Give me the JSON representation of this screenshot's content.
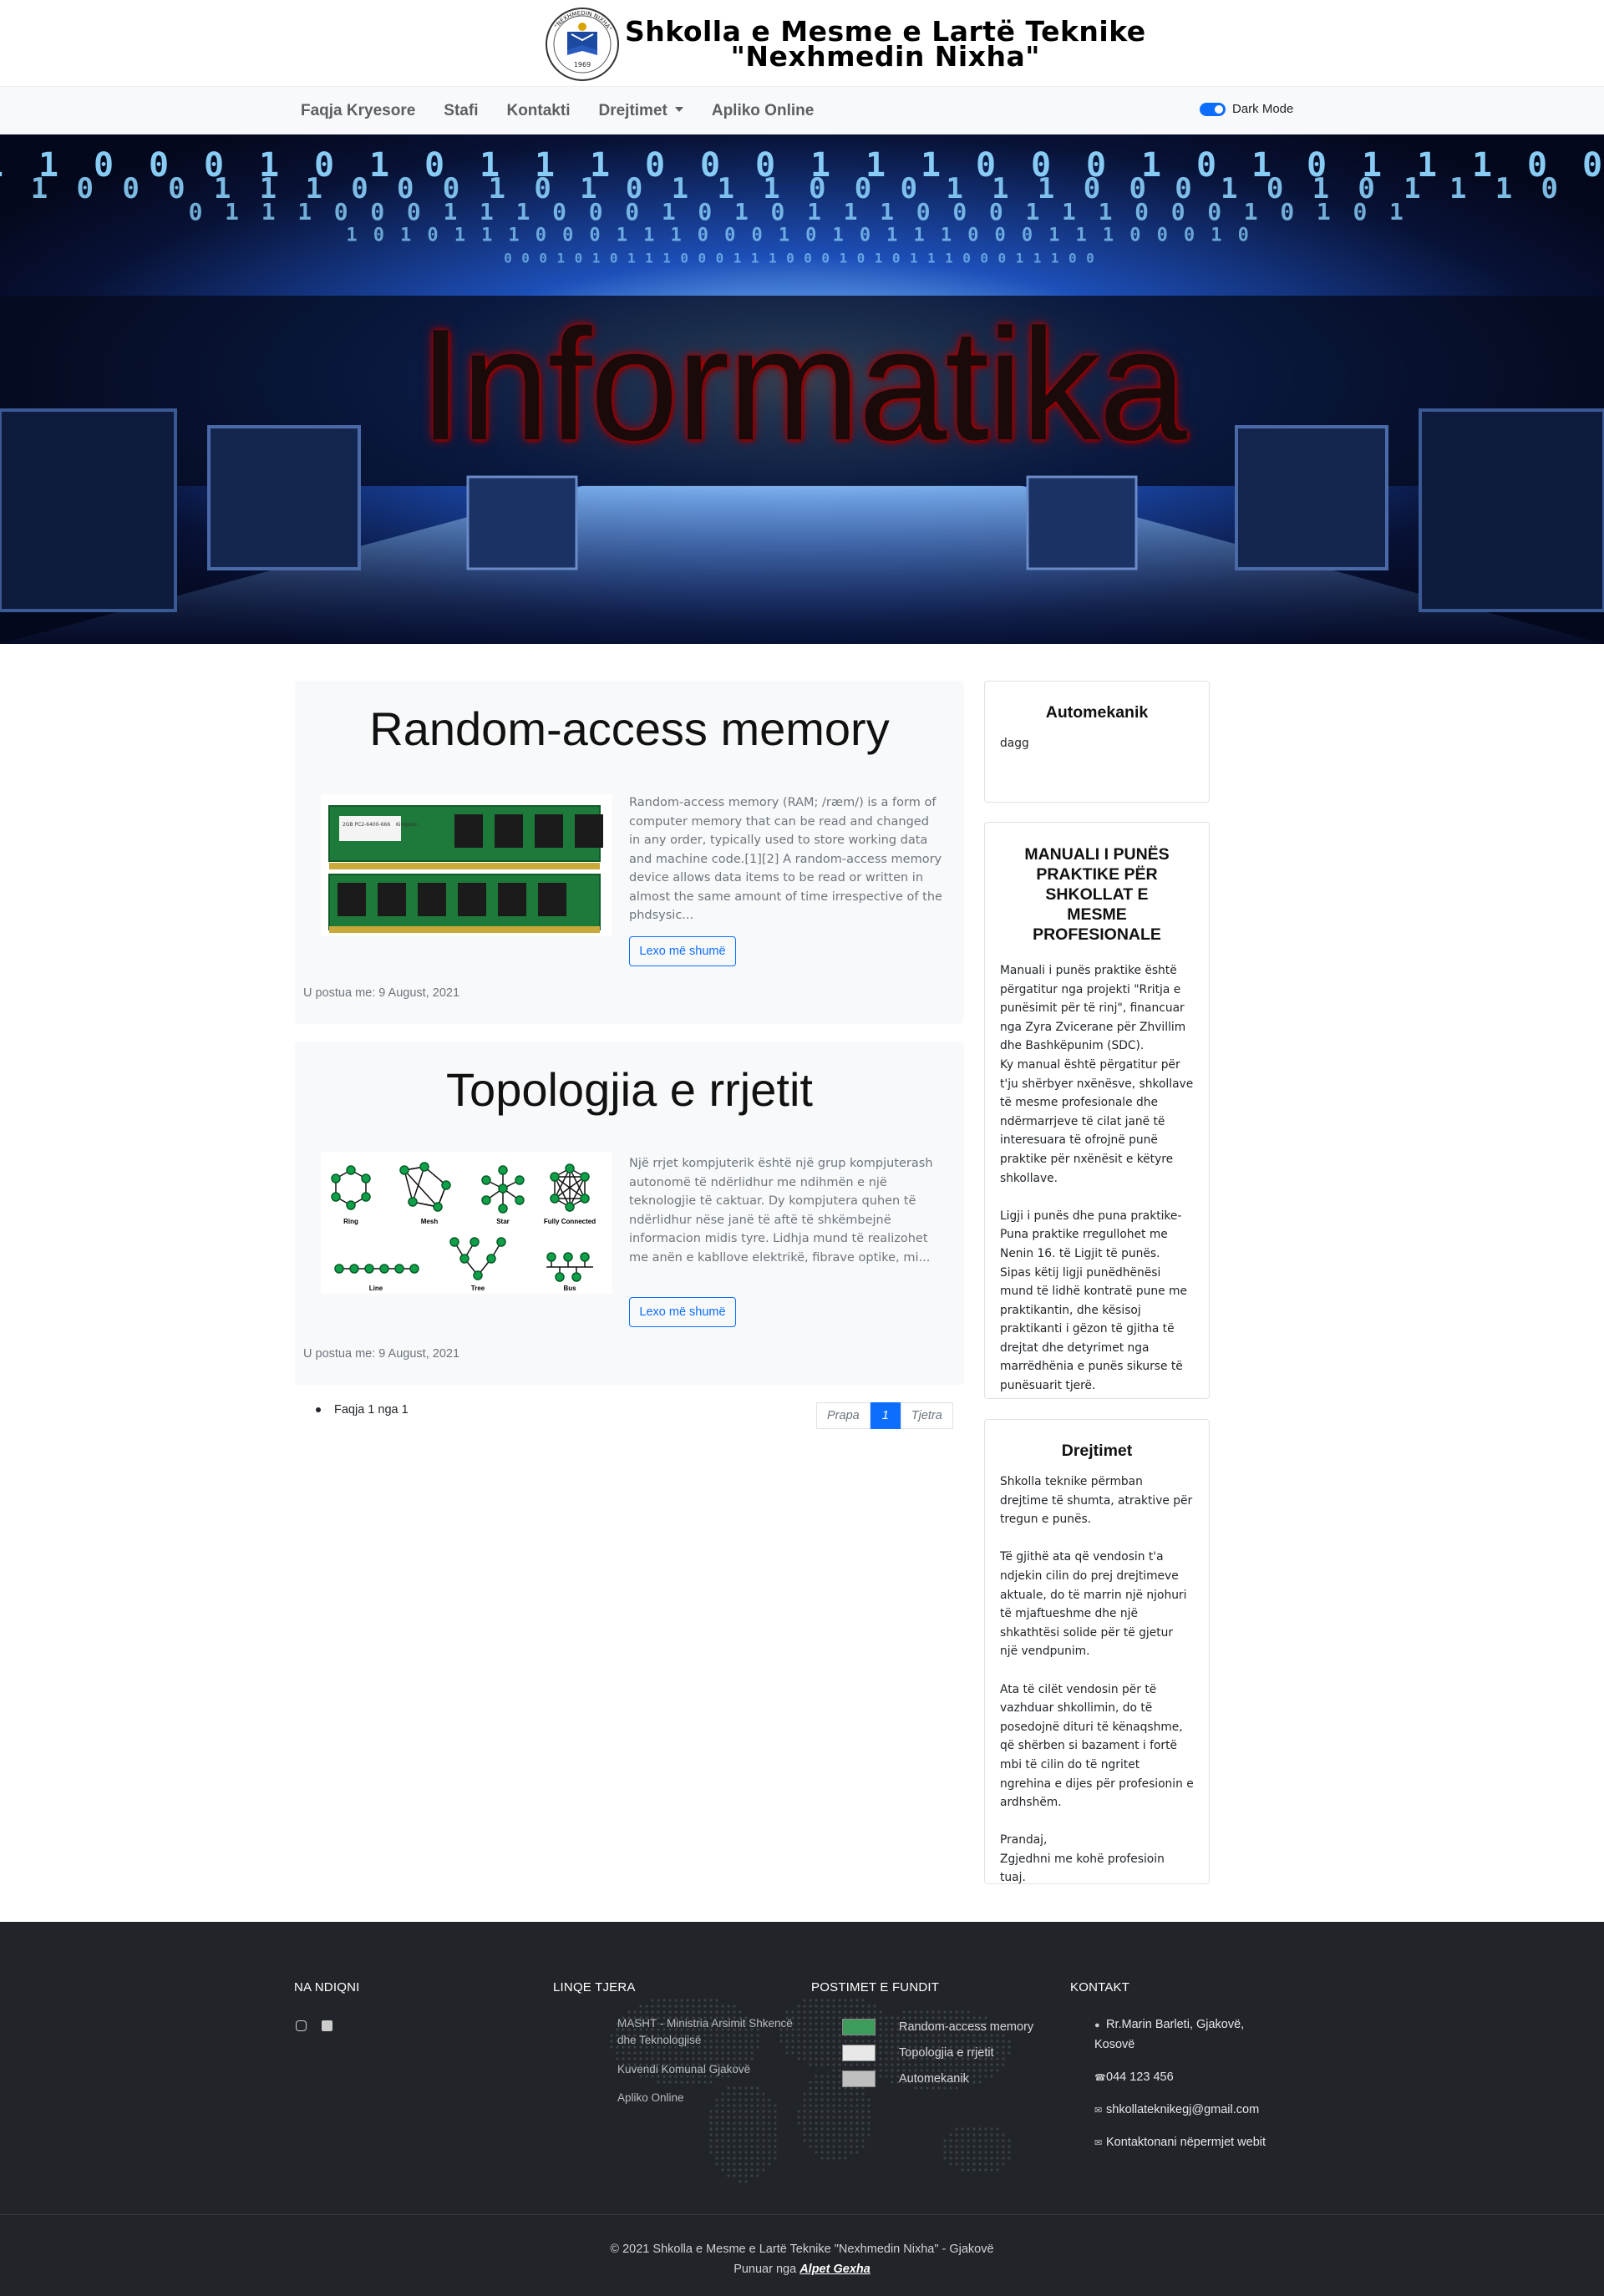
{
  "header": {
    "school_line1": "Shkolla e Mesme e Lartë Teknike",
    "school_line2": "\"Nexhmedin Nixha\"",
    "logo_top_text": "\"NEXHMEDIN NIXHA\"",
    "logo_year": "1969"
  },
  "nav": {
    "items": [
      {
        "label": "Faqja Kryesore"
      },
      {
        "label": "Stafi"
      },
      {
        "label": "Kontakti"
      },
      {
        "label": "Drejtimet"
      },
      {
        "label": "Apliko Online"
      }
    ],
    "dark_mode_label": "Dark Mode",
    "dark_mode_on": true
  },
  "hero": {
    "title": "Informatika",
    "binary_digits": [
      "0",
      "1",
      "0",
      "1",
      "0",
      "1",
      "0",
      "1",
      "0",
      "0",
      "1",
      "0",
      "1",
      "1",
      "0",
      "1"
    ]
  },
  "posts": [
    {
      "title": "Random-access memory",
      "excerpt": "Random-access memory (RAM; /ræm/) is a form of computer memory that can be read and changed in any order, typically used to store working data and machine code.[1][2] A random-access memory device allows data items to be read or written in almost the same amount of time irrespective of the phdsysic...",
      "button": "Lexo më shumë",
      "posted": "U postua me: 9 August, 2021",
      "image_labels": [
        "2GB PC2-6400-666",
        "Kingston"
      ]
    },
    {
      "title": "Topologjia e rrjetit",
      "excerpt": "Një rrjet kompjuterik është një grup kompjuterash autonomë të ndërlidhur me ndihmën e një teknologjie të caktuar. Dy kompjutera quhen të ndërlidhur nëse janë të aftë të shkëmbejnë informacion midis tyre. Lidhja mund të realizohet me anën e kabllove elektrikë, fibrave optike, mi...",
      "button": "Lexo më shumë",
      "posted": "U postua me: 9 August, 2021",
      "image_labels": [
        "Ring",
        "Mesh",
        "Star",
        "Fully Connected",
        "Line",
        "Tree",
        "Bus"
      ]
    }
  ],
  "pagination": {
    "info": "Faqja 1 nga 1",
    "prev": "Prapa",
    "current": "1",
    "next": "Tjetra"
  },
  "sidebar": {
    "cards": [
      {
        "title": "Automekanik",
        "text": "dagg"
      },
      {
        "title": "MANUALI I PUNËS PRAKTIKE PËR SHKOLLAT E MESME PROFESIONALE",
        "text": "Manuali i punës praktike është përgatitur nga projekti \"Rritja e punësimit për të rinj\", financuar nga Zyra Zvicerane për Zhvillim dhe Bashkëpunim (SDC).\nKy manual është përgatitur për t'ju shërbyer nxënësve, shkollave të mesme profesionale dhe ndërmarrjeve të cilat janë të interesuara të ofrojnë punë praktike për nxënësit e këtyre shkollave.\n\nLigji i punës dhe puna praktike- Puna praktike rregullohet me Nenin 16. të Ligjit të punës. Sipas këtij ligji punëdhënësi mund të lidhë kontratë pune me praktikantin, dhe kësisoj praktikanti i gëzon të gjitha të drejtat dhe detyrimet nga marrëdhënia e punës sikurse të punësuarit tjerë."
      },
      {
        "title": "Drejtimet",
        "text": "Shkolla teknike përmban drejtime të shumta, atraktive për tregun e punës.\n\nTë gjithë ata që vendosin t'a ndjekin cilin do prej drejtimeve aktuale, do të marrin një njohuri të mjaftueshme dhe një shkathtësi solide për të gjetur një vendpunim.\n\nAta të cilët vendosin për të vazhduar shkollimin, do të posedojnë dituri të kënaqshme, që shërben si bazament i fortë mbi të cilin do të ngritet ngrehina e dijes për profesionin e ardhshëm.\n\nPrandaj,\nZgjedhni me kohë profesioin tuaj."
      }
    ]
  },
  "footer": {
    "col1": {
      "heading": "NA NDIQNI",
      "icons": [
        "instagram-icon",
        "facebook-icon"
      ]
    },
    "col2": {
      "heading": "LINQE TJERA",
      "links": [
        "MASHT - Ministria Arsimit Shkencë dhe Teknologjisë",
        "Kuvendi Komunal Gjakovë",
        "Apliko Online"
      ]
    },
    "col3": {
      "heading": "POSTIMET E FUNDIT",
      "posts": [
        "Random-access memory",
        "Topologjia e rrjetit",
        "Automekanik"
      ]
    },
    "col4": {
      "heading": "KONTAKT",
      "address": "Rr.Marin Barleti, Gjakovë, Kosovë",
      "phone": "044 123 456",
      "email": "shkollateknikegj@gmail.com",
      "web": "Kontaktonani nëpermjet webit"
    },
    "copyright": "© 2021 Shkolla e Mesme e Lartë Teknike \"Nexhmedin Nixha\" - Gjakovë",
    "made_by_prefix": "Punuar nga",
    "made_by_name": "Alpet Gexha"
  },
  "colors": {
    "primary": "#0d6efd",
    "nav_bg": "#f8f9fa",
    "footer_bg": "#212529",
    "hero_dark": "#0a1230",
    "hero_blue": "#1e4fbf"
  }
}
